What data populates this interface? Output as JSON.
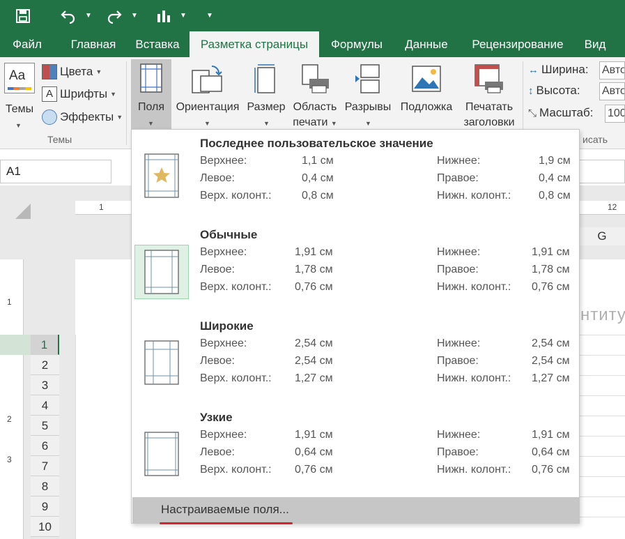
{
  "tabs": [
    "Файл",
    "Главная",
    "Вставка",
    "Разметка страницы",
    "Формулы",
    "Данные",
    "Рецензирование",
    "Вид"
  ],
  "active_tab": "Разметка страницы",
  "ribbon": {
    "themes": {
      "label": "Темы",
      "group_caption": "Темы"
    },
    "colors": "Цвета",
    "fonts": "Шрифты",
    "effects": "Эффекты",
    "margins": "Поля",
    "orientation": "Ориентация",
    "size": "Размер",
    "print_area_line1": "Область",
    "print_area_line2": "печати",
    "breaks": "Разрывы",
    "background": "Подложка",
    "print_titles_line1": "Печатать",
    "print_titles_line2": "заголовки",
    "width_label": "Ширина:",
    "width_value": "Авто",
    "height_label": "Высота:",
    "height_value": "Авто",
    "scale_label": "Масштаб:",
    "scale_value": "100",
    "fit_caption_fragment": "исать"
  },
  "name_box": "A1",
  "sheet": {
    "ruler_top": [
      "1",
      "12"
    ],
    "ruler_left": [
      "1",
      "2",
      "3"
    ],
    "col_g": "G",
    "rows": [
      "1",
      "2",
      "3",
      "4",
      "5",
      "6",
      "7",
      "8",
      "9",
      "10"
    ],
    "header_ghost": "нтиту"
  },
  "margins_menu": {
    "options": [
      {
        "title": "Последнее пользовательское значение",
        "icon": "star-margins-icon",
        "top_label": "Верхнее:",
        "top": "1,1 см",
        "bottom_label": "Нижнее:",
        "bottom": "1,9 см",
        "left_label": "Левое:",
        "left": "0,4 см",
        "right_label": "Правое:",
        "right": "0,4 см",
        "header_label": "Верх. колонт.:",
        "header": "0,8 см",
        "footer_label": "Нижн. колонт.:",
        "footer": "0,8 см"
      },
      {
        "title": "Обычные",
        "icon": "normal-margins-icon",
        "top_label": "Верхнее:",
        "top": "1,91 см",
        "bottom_label": "Нижнее:",
        "bottom": "1,91 см",
        "left_label": "Левое:",
        "left": "1,78 см",
        "right_label": "Правое:",
        "right": "1,78 см",
        "header_label": "Верх. колонт.:",
        "header": "0,76 см",
        "footer_label": "Нижн. колонт.:",
        "footer": "0,76 см"
      },
      {
        "title": "Широкие",
        "icon": "wide-margins-icon",
        "top_label": "Верхнее:",
        "top": "2,54 см",
        "bottom_label": "Нижнее:",
        "bottom": "2,54 см",
        "left_label": "Левое:",
        "left": "2,54 см",
        "right_label": "Правое:",
        "right": "2,54 см",
        "header_label": "Верх. колонт.:",
        "header": "1,27 см",
        "footer_label": "Нижн. колонт.:",
        "footer": "1,27 см"
      },
      {
        "title": "Узкие",
        "icon": "narrow-margins-icon",
        "top_label": "Верхнее:",
        "top": "1,91 см",
        "bottom_label": "Нижнее:",
        "bottom": "1,91 см",
        "left_label": "Левое:",
        "left": "0,64 см",
        "right_label": "Правое:",
        "right": "0,64 см",
        "header_label": "Верх. колонт.:",
        "header": "0,76 см",
        "footer_label": "Нижн. колонт.:",
        "footer": "0,76 см"
      }
    ],
    "custom": "Настраиваемые поля..."
  },
  "colors": {
    "brand_green": "#217346",
    "highlight": "#c6c6c6",
    "underline_red": "#d6232b",
    "star": "#e0b860"
  }
}
